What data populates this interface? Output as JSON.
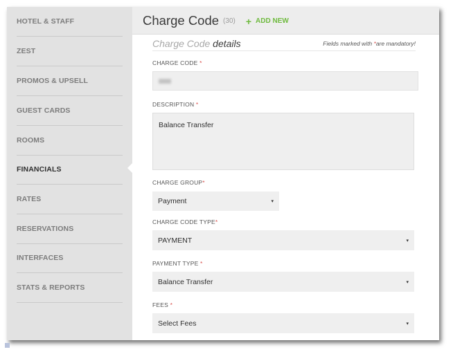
{
  "sidebar": {
    "items": [
      {
        "label": "HOTEL & STAFF"
      },
      {
        "label": "ZEST"
      },
      {
        "label": "PROMOS & UPSELL"
      },
      {
        "label": "GUEST CARDS"
      },
      {
        "label": "ROOMS"
      },
      {
        "label": "FINANCIALS"
      },
      {
        "label": "RATES"
      },
      {
        "label": "RESERVATIONS"
      },
      {
        "label": "INTERFACES"
      },
      {
        "label": "STATS & REPORTS"
      }
    ],
    "active": "FINANCIALS"
  },
  "header": {
    "title": "Charge Code",
    "count": "(30)",
    "add_new_icon": "+",
    "add_new_label": "ADD NEW"
  },
  "section": {
    "title_prefix": "Charge Code",
    "title_suffix": "details",
    "note_prefix": "Fields marked with ",
    "note_star": "*",
    "note_suffix": "are mandatory!"
  },
  "form": {
    "charge_code": {
      "label": "CHARGE CODE",
      "required_mark": "*"
    },
    "description": {
      "label": "DESCRIPTION",
      "required_mark": "*",
      "value": "Balance Transfer"
    },
    "charge_group": {
      "label": "CHARGE GROUP",
      "required_mark": "*",
      "value": "Payment"
    },
    "charge_code_type": {
      "label": "CHARGE CODE TYPE",
      "required_mark": "*",
      "value": "PAYMENT"
    },
    "payment_type": {
      "label": "PAYMENT TYPE",
      "required_mark": "*",
      "value": "Balance Transfer"
    },
    "fees": {
      "label": "FEES",
      "required_mark": "*",
      "value": "Select Fees"
    }
  },
  "icons": {
    "caret": "▾",
    "nav_pointer": "triangle-left"
  },
  "colors": {
    "accent_green": "#6fba3f",
    "required_red": "#d9534f",
    "sidebar_bg": "#e2e2e2"
  }
}
